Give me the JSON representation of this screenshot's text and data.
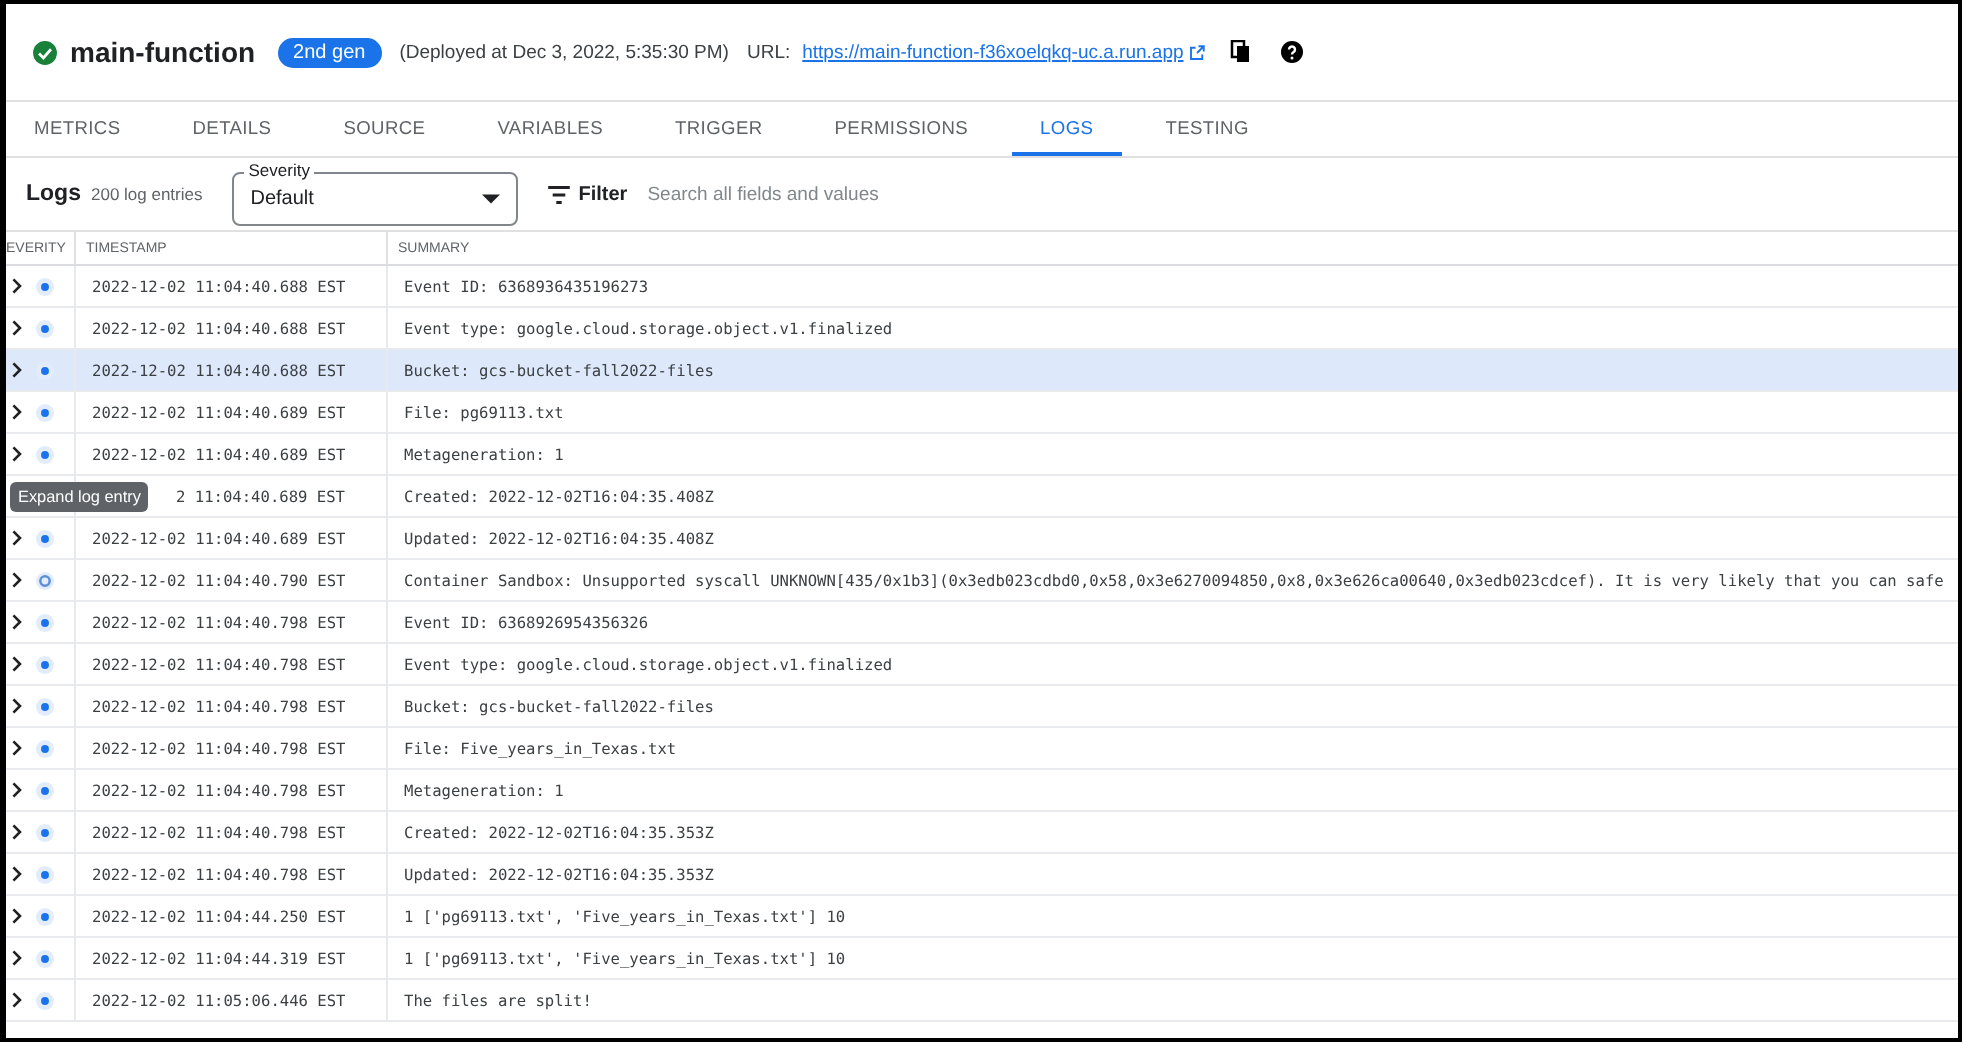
{
  "header": {
    "title": "main-function",
    "badge": "2nd gen",
    "deployed": "(Deployed at Dec 3, 2022, 5:35:30 PM)",
    "url_label": "URL:",
    "url": "https://main-function-f36xoelqkq-uc.a.run.app"
  },
  "tabs": [
    {
      "label": "METRICS",
      "selected": false
    },
    {
      "label": "DETAILS",
      "selected": false
    },
    {
      "label": "SOURCE",
      "selected": false
    },
    {
      "label": "VARIABLES",
      "selected": false
    },
    {
      "label": "TRIGGER",
      "selected": false
    },
    {
      "label": "PERMISSIONS",
      "selected": false
    },
    {
      "label": "LOGS",
      "selected": true
    },
    {
      "label": "TESTING",
      "selected": false
    }
  ],
  "logs_toolbar": {
    "title": "Logs",
    "count": "200 log entries",
    "severity": {
      "label": "Severity",
      "value": "Default"
    },
    "filter": {
      "label": "Filter",
      "placeholder": "Search all fields and values"
    }
  },
  "table": {
    "columns": [
      "EVERITY",
      "TIMESTAMP",
      "SUMMARY"
    ],
    "rows": [
      {
        "kind": "info",
        "timestamp": "2022-12-02 11:04:40.688 EST",
        "summary": "Event ID: 6368936435196273",
        "highlighted": false,
        "tooltip": false
      },
      {
        "kind": "info",
        "timestamp": "2022-12-02 11:04:40.688 EST",
        "summary": "Event type: google.cloud.storage.object.v1.finalized",
        "highlighted": false,
        "tooltip": false
      },
      {
        "kind": "info",
        "timestamp": "2022-12-02 11:04:40.688 EST",
        "summary": "Bucket: gcs-bucket-fall2022-files",
        "highlighted": true,
        "tooltip": false
      },
      {
        "kind": "info",
        "timestamp": "2022-12-02 11:04:40.689 EST",
        "summary": "File: pg69113.txt",
        "highlighted": false,
        "tooltip": false
      },
      {
        "kind": "info",
        "timestamp": "2022-12-02 11:04:40.689 EST",
        "summary": "Metageneration: 1",
        "highlighted": false,
        "tooltip": false
      },
      {
        "timestamp": "2 11:04:40.689 EST",
        "summary": "Created: 2022-12-02T16:04:35.408Z",
        "highlighted": false,
        "tooltip": true
      },
      {
        "kind": "info",
        "timestamp": "2022-12-02 11:04:40.689 EST",
        "summary": "Updated: 2022-12-02T16:04:35.408Z",
        "highlighted": false,
        "tooltip": false
      },
      {
        "kind": "default",
        "timestamp": "2022-12-02 11:04:40.790 EST",
        "summary": "Container Sandbox: Unsupported syscall UNKNOWN[435/0x1b3](0x3edb023cdbd0,0x58,0x3e6270094850,0x8,0x3e626ca00640,0x3edb023cdcef). It is very likely that you can safe",
        "highlighted": false,
        "tooltip": false
      },
      {
        "kind": "info",
        "timestamp": "2022-12-02 11:04:40.798 EST",
        "summary": "Event ID: 6368926954356326",
        "highlighted": false,
        "tooltip": false
      },
      {
        "kind": "info",
        "timestamp": "2022-12-02 11:04:40.798 EST",
        "summary": "Event type: google.cloud.storage.object.v1.finalized",
        "highlighted": false,
        "tooltip": false
      },
      {
        "kind": "info",
        "timestamp": "2022-12-02 11:04:40.798 EST",
        "summary": "Bucket: gcs-bucket-fall2022-files",
        "highlighted": false,
        "tooltip": false
      },
      {
        "kind": "info",
        "timestamp": "2022-12-02 11:04:40.798 EST",
        "summary": "File: Five_years_in_Texas.txt",
        "highlighted": false,
        "tooltip": false
      },
      {
        "kind": "info",
        "timestamp": "2022-12-02 11:04:40.798 EST",
        "summary": "Metageneration: 1",
        "highlighted": false,
        "tooltip": false
      },
      {
        "kind": "info",
        "timestamp": "2022-12-02 11:04:40.798 EST",
        "summary": "Created: 2022-12-02T16:04:35.353Z",
        "highlighted": false,
        "tooltip": false
      },
      {
        "kind": "info",
        "timestamp": "2022-12-02 11:04:40.798 EST",
        "summary": "Updated: 2022-12-02T16:04:35.353Z",
        "highlighted": false,
        "tooltip": false
      },
      {
        "kind": "info",
        "timestamp": "2022-12-02 11:04:44.250 EST",
        "summary": "1 ['pg69113.txt', 'Five_years_in_Texas.txt'] 10",
        "highlighted": false,
        "tooltip": false
      },
      {
        "kind": "info",
        "timestamp": "2022-12-02 11:04:44.319 EST",
        "summary": "1 ['pg69113.txt', 'Five_years_in_Texas.txt'] 10",
        "highlighted": false,
        "tooltip": false
      },
      {
        "kind": "info",
        "timestamp": "2022-12-02 11:05:06.446 EST",
        "summary": "The files are split!",
        "highlighted": false,
        "tooltip": false
      }
    ]
  },
  "tooltip": {
    "text": "Expand log entry"
  }
}
